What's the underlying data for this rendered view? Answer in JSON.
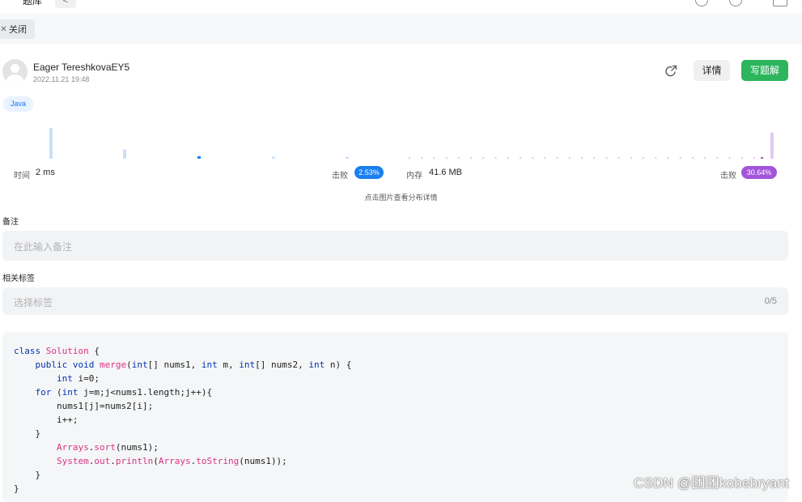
{
  "topbar": {
    "tab_title": "题库",
    "back_glyph": "<"
  },
  "close_button": {
    "label": "关闭"
  },
  "submission": {
    "username": "Eager TereshkovaEY5",
    "timestamp": "2022.11.21 19:48",
    "language": "Java",
    "detail_label": "详情",
    "write_solution_label": "写题解",
    "share_icon": "share-icon"
  },
  "stats": {
    "time_label": "时间",
    "time_value": "2 ms",
    "time_beats_label": "击败",
    "time_beats": "2.53%",
    "memory_label": "内存",
    "memory_value": "41.6 MB",
    "memory_beats_label": "击败",
    "memory_beats": "30.64%",
    "hint": "点击图片查看分布详情",
    "colors": {
      "time": "#1a7ff0",
      "memory": "#a355d9"
    },
    "time_bars": [
      1.0,
      0.3,
      0.08,
      0.06,
      0.06
    ],
    "memory_dots": 29,
    "memory_peak": 0.85
  },
  "notes": {
    "label": "备注",
    "placeholder": "在此输入备注"
  },
  "tags": {
    "label": "相关标签",
    "placeholder": "选择标签",
    "counter": "0/5"
  },
  "code_lines": [
    "class Solution {",
    "    public void merge(int[] nums1, int m, int[] nums2, int n) {",
    "        int i=0;",
    "    for (int j=m;j<nums1.length;j++){",
    "        nums1[j]=nums2[i];",
    "        i++;",
    "    }",
    "        Arrays.sort(nums1);",
    "        System.out.println(Arrays.toString(nums1));",
    "    }",
    "}"
  ],
  "watermark": "CSDN @团团kobebryant"
}
